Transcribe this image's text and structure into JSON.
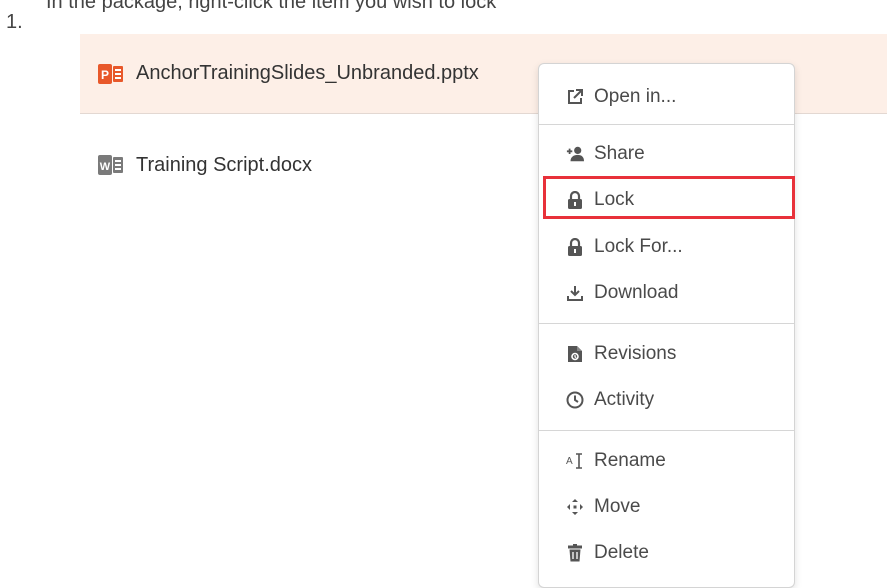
{
  "step": {
    "number": "1."
  },
  "instruction_fragment": "In the package, right-click the item you wish to lock",
  "files": [
    {
      "name": "AnchorTrainingSlides_Unbranded.pptx",
      "type": "pptx",
      "selected": true
    },
    {
      "name": "Training Script.docx",
      "type": "docx",
      "selected": false
    }
  ],
  "context_menu": {
    "groups": [
      [
        {
          "label": "Open in...",
          "icon": "external-link-icon"
        }
      ],
      [
        {
          "label": "Share",
          "icon": "user-plus-icon"
        },
        {
          "label": "Lock",
          "icon": "lock-icon"
        },
        {
          "label": "Lock For...",
          "icon": "lock-icon"
        },
        {
          "label": "Download",
          "icon": "download-icon"
        }
      ],
      [
        {
          "label": "Revisions",
          "icon": "file-revisions-icon"
        },
        {
          "label": "Activity",
          "icon": "clock-icon"
        }
      ],
      [
        {
          "label": "Rename",
          "icon": "rename-cursor-icon"
        },
        {
          "label": "Move",
          "icon": "move-arrows-icon"
        },
        {
          "label": "Delete",
          "icon": "trash-icon"
        }
      ]
    ],
    "highlighted_item": "Lock"
  },
  "colors": {
    "selected_row_bg": "#fdefe7",
    "pptx_icon": "#e8582a",
    "docx_icon": "#7a7a7a",
    "highlight_border": "#e8313a",
    "menu_text": "#4a4a4a"
  }
}
